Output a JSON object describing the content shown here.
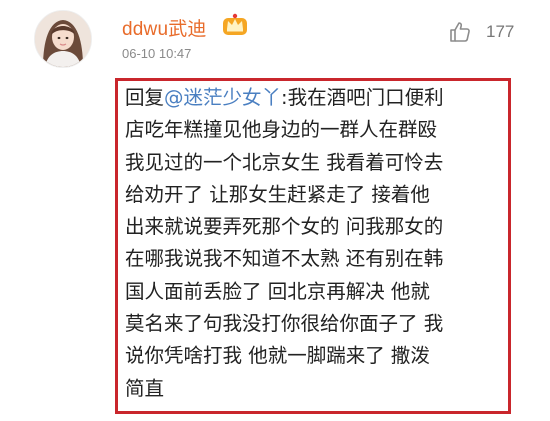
{
  "comment": {
    "username": "ddwu武迪",
    "timestamp": "06-10 10:47",
    "like_count": "177",
    "icons": {
      "avatar": "user-avatar-photo",
      "badge": "vip-crown-icon",
      "like": "thumbs-up-icon"
    },
    "colors": {
      "username": "#e86b2a",
      "mention": "#4a7fc1",
      "highlight_border": "#c9262c"
    },
    "reply": {
      "prefix": "回复",
      "mention": "@迷茫少女丫",
      "lines": [
        ":我在酒吧门口便利",
        "店吃年糕撞见他身边的一群人在群殴",
        "我见过的一个北京女生 我看着可怜去",
        "给劝开了 让那女生赶紧走了 接着他",
        "出来就说要弄死那个女的 问我那女的",
        "在哪我说我不知道不太熟 还有别在韩",
        "国人面前丢脸了 回北京再解决 他就",
        "莫名来了句我没打你很给你面子了 我",
        "说你凭啥打我 他就一脚踹来了 撒泼",
        "简直"
      ]
    }
  }
}
